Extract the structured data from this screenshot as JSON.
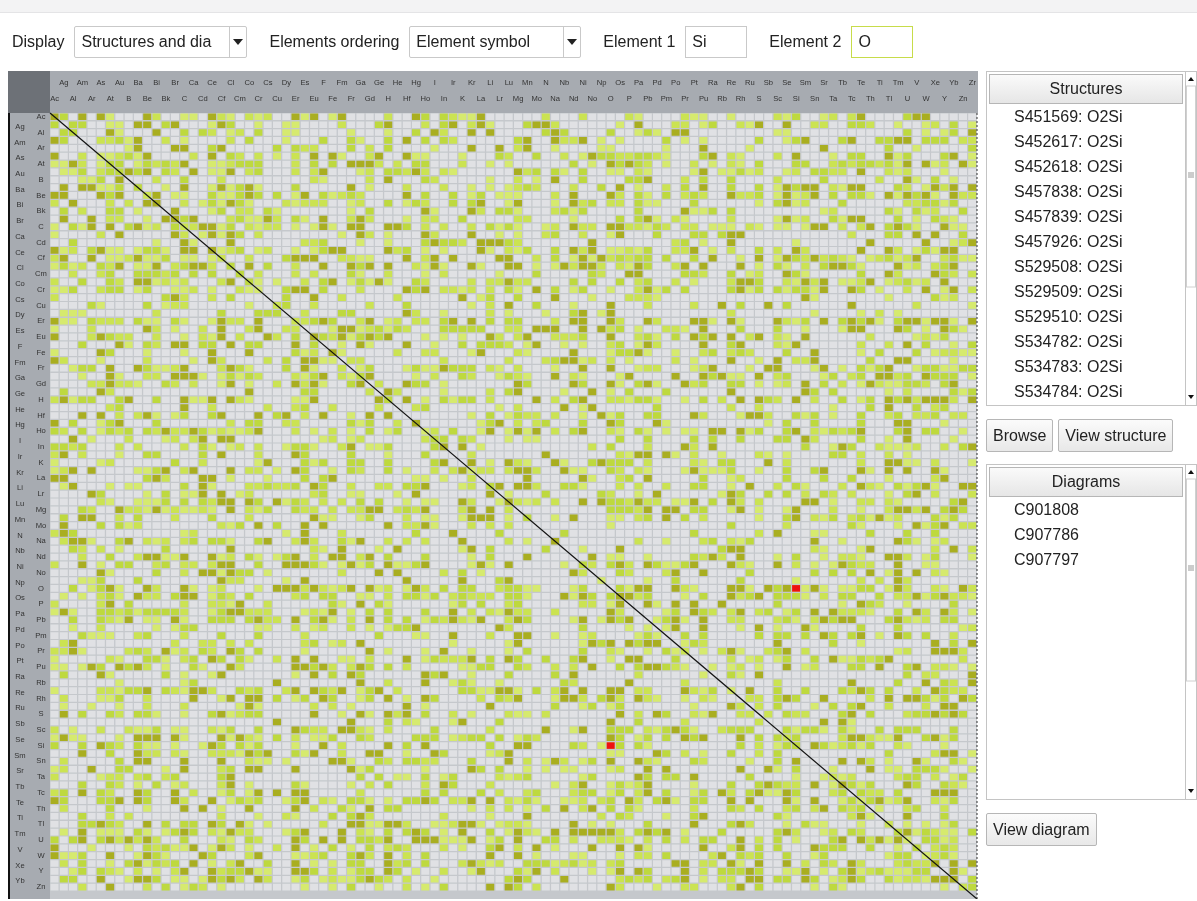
{
  "toolbar": {
    "display": {
      "label": "Display",
      "value": "Structures and dia"
    },
    "ordering": {
      "label": "Elements ordering",
      "value": "Element symbol"
    },
    "element1": {
      "label": "Element 1",
      "value": "Si",
      "focused": false
    },
    "element2": {
      "label": "Element 2",
      "value": "O",
      "focused": true
    }
  },
  "matrix": {
    "columns": [
      {
        "symbol": "Ac",
        "selected": false
      },
      {
        "symbol": "Ag",
        "selected": false
      },
      {
        "symbol": "Al",
        "selected": false
      },
      {
        "symbol": "Am",
        "selected": false
      },
      {
        "symbol": "Ar",
        "selected": false
      },
      {
        "symbol": "As",
        "selected": false
      },
      {
        "symbol": "At",
        "selected": false
      },
      {
        "symbol": "Au",
        "selected": false
      },
      {
        "symbol": "B",
        "selected": false
      },
      {
        "symbol": "Ba",
        "selected": false
      },
      {
        "symbol": "Be",
        "selected": false
      },
      {
        "symbol": "Bi",
        "selected": false
      },
      {
        "symbol": "Bk",
        "selected": false
      },
      {
        "symbol": "Br",
        "selected": false
      },
      {
        "symbol": "C",
        "selected": false
      },
      {
        "symbol": "Ca",
        "selected": false
      },
      {
        "symbol": "Cd",
        "selected": false
      },
      {
        "symbol": "Ce",
        "selected": false
      },
      {
        "symbol": "Cf",
        "selected": false
      },
      {
        "symbol": "Cl",
        "selected": false
      },
      {
        "symbol": "Cm",
        "selected": false
      },
      {
        "symbol": "Co",
        "selected": false
      },
      {
        "symbol": "Cr",
        "selected": false
      },
      {
        "symbol": "Cs",
        "selected": false
      },
      {
        "symbol": "Cu",
        "selected": false
      },
      {
        "symbol": "Dy",
        "selected": false
      },
      {
        "symbol": "Er",
        "selected": false
      },
      {
        "symbol": "Es",
        "selected": false
      },
      {
        "symbol": "Eu",
        "selected": false
      },
      {
        "symbol": "F",
        "selected": false
      },
      {
        "symbol": "Fe",
        "selected": false
      },
      {
        "symbol": "Fm",
        "selected": false
      },
      {
        "symbol": "Fr",
        "selected": false
      },
      {
        "symbol": "Ga",
        "selected": false
      },
      {
        "symbol": "Gd",
        "selected": false
      },
      {
        "symbol": "Ge",
        "selected": false
      },
      {
        "symbol": "H",
        "selected": false
      },
      {
        "symbol": "He",
        "selected": false
      },
      {
        "symbol": "Hf",
        "selected": false
      },
      {
        "symbol": "Hg",
        "selected": false
      },
      {
        "symbol": "Ho",
        "selected": false
      },
      {
        "symbol": "I",
        "selected": false
      },
      {
        "symbol": "In",
        "selected": false
      },
      {
        "symbol": "Ir",
        "selected": false
      },
      {
        "symbol": "K",
        "selected": false
      },
      {
        "symbol": "Kr",
        "selected": false
      },
      {
        "symbol": "La",
        "selected": false
      },
      {
        "symbol": "Li",
        "selected": false
      },
      {
        "symbol": "Lr",
        "selected": false
      },
      {
        "symbol": "Lu",
        "selected": false
      },
      {
        "symbol": "Mg",
        "selected": false
      },
      {
        "symbol": "Mn",
        "selected": false
      },
      {
        "symbol": "Mo",
        "selected": false
      },
      {
        "symbol": "N",
        "selected": false
      },
      {
        "symbol": "Na",
        "selected": false
      },
      {
        "symbol": "Nb",
        "selected": false
      },
      {
        "symbol": "Nd",
        "selected": false
      },
      {
        "symbol": "Ni",
        "selected": false
      },
      {
        "symbol": "No",
        "selected": false
      },
      {
        "symbol": "Np",
        "selected": false
      },
      {
        "symbol": "O",
        "selected": true
      },
      {
        "symbol": "Os",
        "selected": false
      },
      {
        "symbol": "P",
        "selected": false
      },
      {
        "symbol": "Pa",
        "selected": false
      },
      {
        "symbol": "Pb",
        "selected": false
      },
      {
        "symbol": "Pd",
        "selected": false
      },
      {
        "symbol": "Pm",
        "selected": false
      },
      {
        "symbol": "Po",
        "selected": false
      },
      {
        "symbol": "Pr",
        "selected": false
      },
      {
        "symbol": "Pt",
        "selected": false
      },
      {
        "symbol": "Pu",
        "selected": false
      },
      {
        "symbol": "Ra",
        "selected": false
      },
      {
        "symbol": "Rb",
        "selected": false
      },
      {
        "symbol": "Re",
        "selected": false
      },
      {
        "symbol": "Rh",
        "selected": false
      },
      {
        "symbol": "Ru",
        "selected": false
      },
      {
        "symbol": "S",
        "selected": false
      },
      {
        "symbol": "Sb",
        "selected": false
      },
      {
        "symbol": "Sc",
        "selected": false
      },
      {
        "symbol": "Se",
        "selected": false
      },
      {
        "symbol": "Si",
        "selected": true
      },
      {
        "symbol": "Sm",
        "selected": false
      },
      {
        "symbol": "Sn",
        "selected": false
      },
      {
        "symbol": "Sr",
        "selected": false
      },
      {
        "symbol": "Ta",
        "selected": false
      },
      {
        "symbol": "Tb",
        "selected": false
      },
      {
        "symbol": "Tc",
        "selected": false
      },
      {
        "symbol": "Te",
        "selected": false
      },
      {
        "symbol": "Th",
        "selected": false
      },
      {
        "symbol": "Ti",
        "selected": false
      },
      {
        "symbol": "Tl",
        "selected": false
      },
      {
        "symbol": "Tm",
        "selected": false
      },
      {
        "symbol": "U",
        "selected": false
      },
      {
        "symbol": "V",
        "selected": false
      },
      {
        "symbol": "W",
        "selected": false
      },
      {
        "symbol": "Xe",
        "selected": false
      },
      {
        "symbol": "Y",
        "selected": false
      },
      {
        "symbol": "Yb",
        "selected": false
      },
      {
        "symbol": "Zn",
        "selected": false
      },
      {
        "symbol": "Zr",
        "selected": false
      }
    ],
    "rows": [
      {
        "symbol": "Ac",
        "selected": false
      },
      {
        "symbol": "Ag",
        "selected": false
      },
      {
        "symbol": "Al",
        "selected": false
      },
      {
        "symbol": "Am",
        "selected": false
      },
      {
        "symbol": "Ar",
        "selected": false
      },
      {
        "symbol": "As",
        "selected": false
      },
      {
        "symbol": "At",
        "selected": false
      },
      {
        "symbol": "Au",
        "selected": false
      },
      {
        "symbol": "B",
        "selected": false
      },
      {
        "symbol": "Ba",
        "selected": false
      },
      {
        "symbol": "Be",
        "selected": false
      },
      {
        "symbol": "Bi",
        "selected": false
      },
      {
        "symbol": "Bk",
        "selected": false
      },
      {
        "symbol": "Br",
        "selected": false
      },
      {
        "symbol": "C",
        "selected": false
      },
      {
        "symbol": "Ca",
        "selected": false
      },
      {
        "symbol": "Cd",
        "selected": false
      },
      {
        "symbol": "Ce",
        "selected": false
      },
      {
        "symbol": "Cf",
        "selected": false
      },
      {
        "symbol": "Cl",
        "selected": false
      },
      {
        "symbol": "Cm",
        "selected": false
      },
      {
        "symbol": "Co",
        "selected": false
      },
      {
        "symbol": "Cr",
        "selected": false
      },
      {
        "symbol": "Cs",
        "selected": false
      },
      {
        "symbol": "Cu",
        "selected": false
      },
      {
        "symbol": "Dy",
        "selected": false
      },
      {
        "symbol": "Er",
        "selected": false
      },
      {
        "symbol": "Es",
        "selected": false
      },
      {
        "symbol": "Eu",
        "selected": false
      },
      {
        "symbol": "F",
        "selected": false
      },
      {
        "symbol": "Fe",
        "selected": false
      },
      {
        "symbol": "Fm",
        "selected": false
      },
      {
        "symbol": "Fr",
        "selected": false
      },
      {
        "symbol": "Ga",
        "selected": false
      },
      {
        "symbol": "Gd",
        "selected": false
      },
      {
        "symbol": "Ge",
        "selected": false
      },
      {
        "symbol": "H",
        "selected": false
      },
      {
        "symbol": "He",
        "selected": false
      },
      {
        "symbol": "Hf",
        "selected": false
      },
      {
        "symbol": "Hg",
        "selected": false
      },
      {
        "symbol": "Ho",
        "selected": false
      },
      {
        "symbol": "I",
        "selected": false
      },
      {
        "symbol": "In",
        "selected": false
      },
      {
        "symbol": "Ir",
        "selected": false
      },
      {
        "symbol": "K",
        "selected": false
      },
      {
        "symbol": "Kr",
        "selected": false
      },
      {
        "symbol": "La",
        "selected": false
      },
      {
        "symbol": "Li",
        "selected": false
      },
      {
        "symbol": "Lr",
        "selected": false
      },
      {
        "symbol": "Lu",
        "selected": false
      },
      {
        "symbol": "Mg",
        "selected": false
      },
      {
        "symbol": "Mn",
        "selected": false
      },
      {
        "symbol": "Mo",
        "selected": false
      },
      {
        "symbol": "N",
        "selected": false
      },
      {
        "symbol": "Na",
        "selected": false
      },
      {
        "symbol": "Nb",
        "selected": false
      },
      {
        "symbol": "Nd",
        "selected": false
      },
      {
        "symbol": "Ni",
        "selected": false
      },
      {
        "symbol": "No",
        "selected": false
      },
      {
        "symbol": "Np",
        "selected": false
      },
      {
        "symbol": "O",
        "selected": true
      },
      {
        "symbol": "Os",
        "selected": false
      },
      {
        "symbol": "P",
        "selected": false
      },
      {
        "symbol": "Pa",
        "selected": false
      },
      {
        "symbol": "Pb",
        "selected": false
      },
      {
        "symbol": "Pd",
        "selected": false
      },
      {
        "symbol": "Pm",
        "selected": false
      },
      {
        "symbol": "Po",
        "selected": false
      },
      {
        "symbol": "Pr",
        "selected": false
      },
      {
        "symbol": "Pt",
        "selected": false
      },
      {
        "symbol": "Pu",
        "selected": false
      },
      {
        "symbol": "Ra",
        "selected": false
      },
      {
        "symbol": "Rb",
        "selected": false
      },
      {
        "symbol": "Re",
        "selected": false
      },
      {
        "symbol": "Rh",
        "selected": false
      },
      {
        "symbol": "Ru",
        "selected": false
      },
      {
        "symbol": "S",
        "selected": false
      },
      {
        "symbol": "Sb",
        "selected": false
      },
      {
        "symbol": "Sc",
        "selected": false
      },
      {
        "symbol": "Se",
        "selected": false
      },
      {
        "symbol": "Si",
        "selected": true
      },
      {
        "symbol": "Sm",
        "selected": false
      },
      {
        "symbol": "Sn",
        "selected": false
      },
      {
        "symbol": "Sr",
        "selected": false
      },
      {
        "symbol": "Ta",
        "selected": false
      },
      {
        "symbol": "Tb",
        "selected": false
      },
      {
        "symbol": "Tc",
        "selected": false
      },
      {
        "symbol": "Te",
        "selected": false
      },
      {
        "symbol": "Th",
        "selected": false
      },
      {
        "symbol": "Ti",
        "selected": false
      },
      {
        "symbol": "Tl",
        "selected": false
      },
      {
        "symbol": "Tm",
        "selected": false
      },
      {
        "symbol": "U",
        "selected": false
      },
      {
        "symbol": "V",
        "selected": false
      },
      {
        "symbol": "W",
        "selected": false
      },
      {
        "symbol": "Xe",
        "selected": false
      },
      {
        "symbol": "Y",
        "selected": false
      },
      {
        "symbol": "Yb",
        "selected": false
      },
      {
        "symbol": "Zn",
        "selected": false
      }
    ]
  },
  "structures": {
    "header": "Structures",
    "items": [
      "S451569: O2Si",
      "S452617: O2Si",
      "S452618: O2Si",
      "S457838: O2Si",
      "S457839: O2Si",
      "S457926: O2Si",
      "S529508: O2Si",
      "S529509: O2Si",
      "S529510: O2Si",
      "S534782: O2Si",
      "S534783: O2Si",
      "S534784: O2Si"
    ],
    "buttons": [
      "Browse",
      "View structure"
    ]
  },
  "diagrams": {
    "header": "Diagrams",
    "items": [
      "C901808",
      "C907786",
      "C907797"
    ],
    "buttons": [
      "View diagram"
    ]
  }
}
